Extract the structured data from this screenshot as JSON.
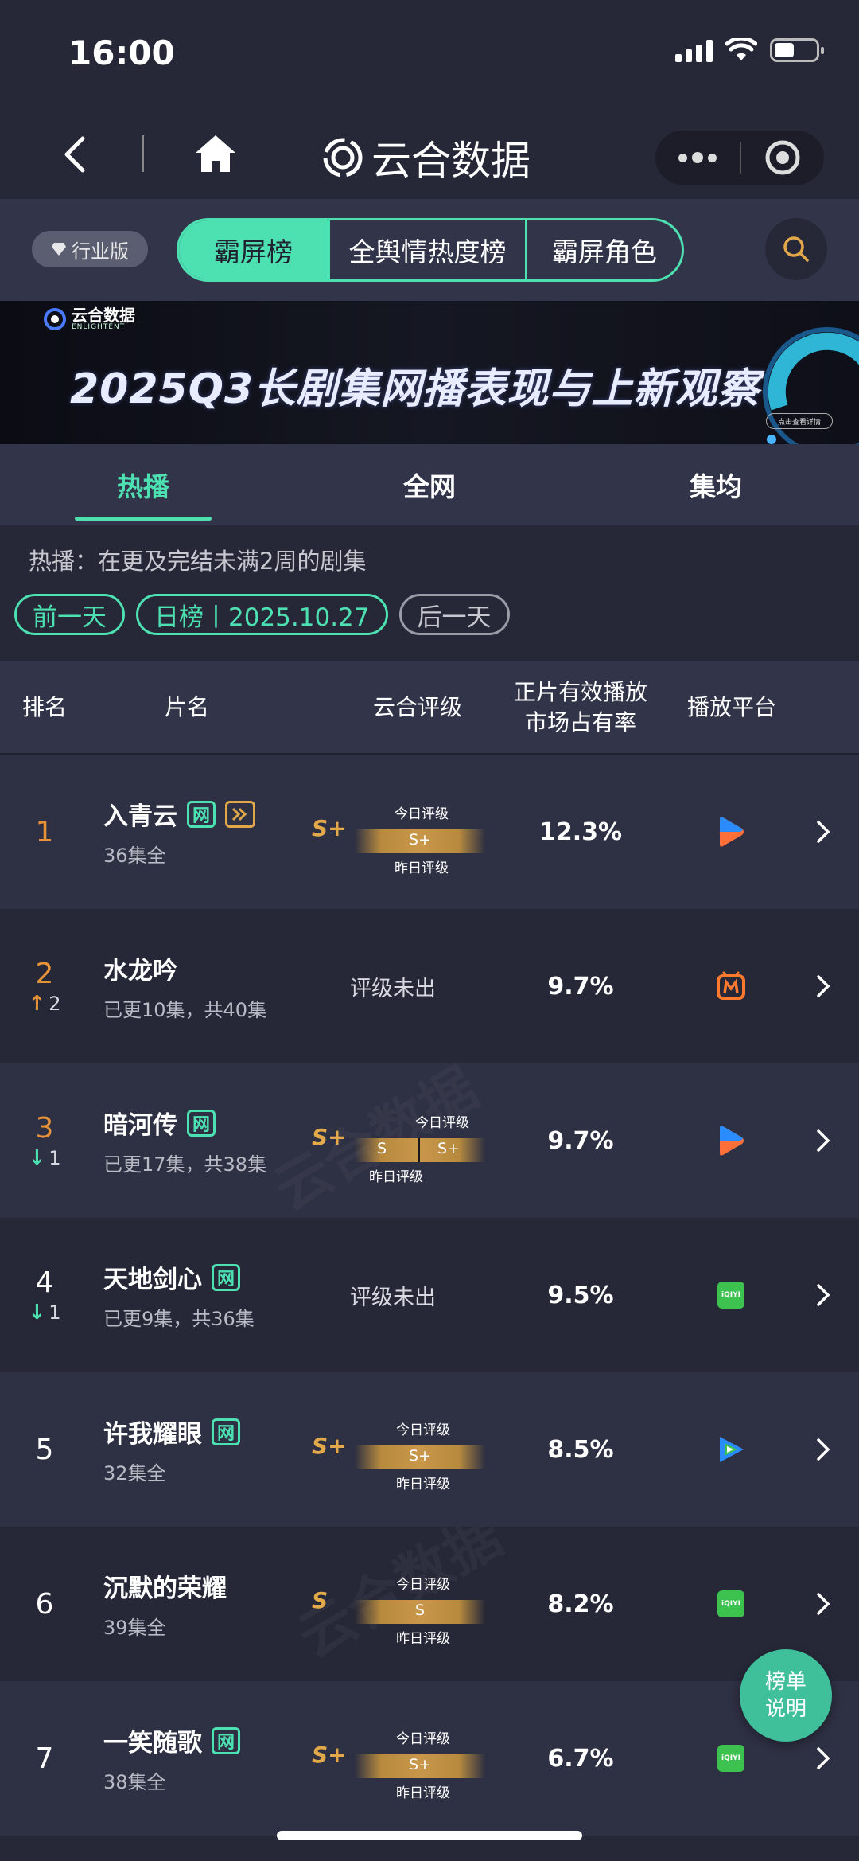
{
  "status_bar": {
    "time": "16:00"
  },
  "nav": {
    "title": "云合数据"
  },
  "switcher": {
    "edition": "行业版",
    "tabs": [
      "霸屏榜",
      "全舆情热度榜",
      "霸屏角色"
    ]
  },
  "banner": {
    "logo_text": "云合数据",
    "logo_sub": "ENLIGHTENT",
    "title": "2025Q3长剧集网播表现与上新观察",
    "cta": "点击查看详情"
  },
  "sub_tabs": [
    "热播",
    "全网",
    "集均"
  ],
  "filter": {
    "description": "热播：在更及完结未满2周的剧集",
    "prev_day": "前一天",
    "date_label": "日榜丨2025.10.27",
    "next_day": "后一天"
  },
  "table_header": {
    "rank": "排名",
    "name": "片名",
    "grade": "云合评级",
    "share_line1": "正片有效播放",
    "share_line2": "市场占有率",
    "platform": "播放平台"
  },
  "grade_labels": {
    "today": "今日评级",
    "yesterday": "昨日评级",
    "not_out": "评级未出"
  },
  "rows": [
    {
      "rank": "1",
      "change": "",
      "title": "入青云",
      "sub": "36集全",
      "grade": "S+",
      "grade_today": "S+",
      "grade_yesterday": "S+",
      "share": "12.3%",
      "platform": "tencent-video"
    },
    {
      "rank": "2",
      "change": "2",
      "title": "水龙吟",
      "sub": "已更10集，共40集",
      "grade": "",
      "share": "9.7%",
      "platform": "mango-tv"
    },
    {
      "rank": "3",
      "change": "1",
      "title": "暗河传",
      "sub": "已更17集，共38集",
      "grade": "S+",
      "grade_today": "S+",
      "grade_yesterday": "S",
      "share": "9.7%",
      "platform": "tencent-video"
    },
    {
      "rank": "4",
      "change": "1",
      "title": "天地剑心",
      "sub": "已更9集，共36集",
      "grade": "",
      "share": "9.5%",
      "platform": "iqiyi"
    },
    {
      "rank": "5",
      "change": "",
      "title": "许我耀眼",
      "sub": "32集全",
      "grade": "S+",
      "grade_today": "S+",
      "grade_yesterday": "S+",
      "share": "8.5%",
      "platform": "tencent-video-alt"
    },
    {
      "rank": "6",
      "change": "",
      "title": "沉默的荣耀",
      "sub": "39集全",
      "grade": "S",
      "grade_today": "S",
      "grade_yesterday": "S",
      "share": "8.2%",
      "platform": "iqiyi"
    },
    {
      "rank": "7",
      "change": "",
      "title": "一笑随歌",
      "sub": "38集全",
      "grade": "S+",
      "grade_today": "S+",
      "grade_yesterday": "S+",
      "share": "6.7%",
      "platform": "iqiyi"
    }
  ],
  "tags": {
    "net": "网",
    "iqiyi_text": "iQIYI"
  },
  "fab": {
    "line1": "榜单",
    "line2": "说明"
  },
  "watermark": {
    "text": "云合数据",
    "sub": "ENLIGHTENT"
  },
  "colors": {
    "accent": "#4de0b1",
    "grade_gold": "#e2a94a",
    "rank_top": "#e8923a",
    "bg": "#262838"
  }
}
